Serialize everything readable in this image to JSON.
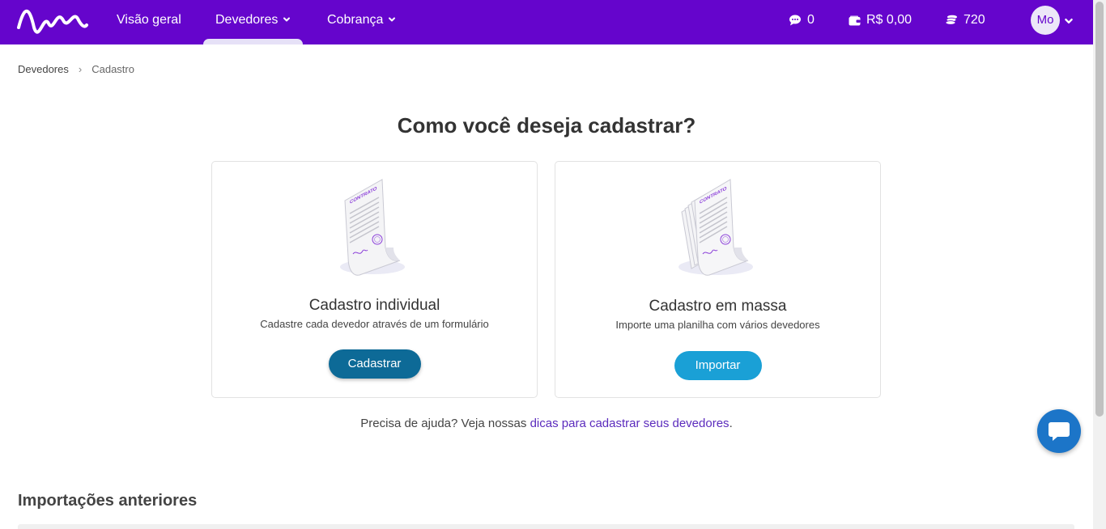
{
  "nav": {
    "items": [
      {
        "label": "Visão geral"
      },
      {
        "label": "Devedores"
      },
      {
        "label": "Cobrança"
      }
    ],
    "messages_count": "0",
    "balance": "R$ 0,00",
    "credits": "720",
    "avatar_initials": "Mo"
  },
  "breadcrumb": {
    "root": "Devedores",
    "current": "Cadastro"
  },
  "headline": "Como você deseja cadastrar?",
  "cards": [
    {
      "title": "Cadastro individual",
      "description": "Cadastre cada devedor através de um formulário",
      "button": "Cadastrar",
      "illustration_label": "CONTRATO"
    },
    {
      "title": "Cadastro em massa",
      "description": "Importe uma planilha com vários devedores",
      "button": "Importar",
      "illustration_label": "CONTRATO"
    }
  ],
  "help": {
    "prefix": "Precisa de ajuda? Veja nossas ",
    "link": "dicas para cadastrar seus devedores",
    "suffix": "."
  },
  "section_title": "Importações anteriores",
  "colors": {
    "brand_purple": "#6505cc",
    "button_dark": "#0d6a97",
    "button_light": "#1aa0d6",
    "chat_fab": "#1c75c8"
  }
}
